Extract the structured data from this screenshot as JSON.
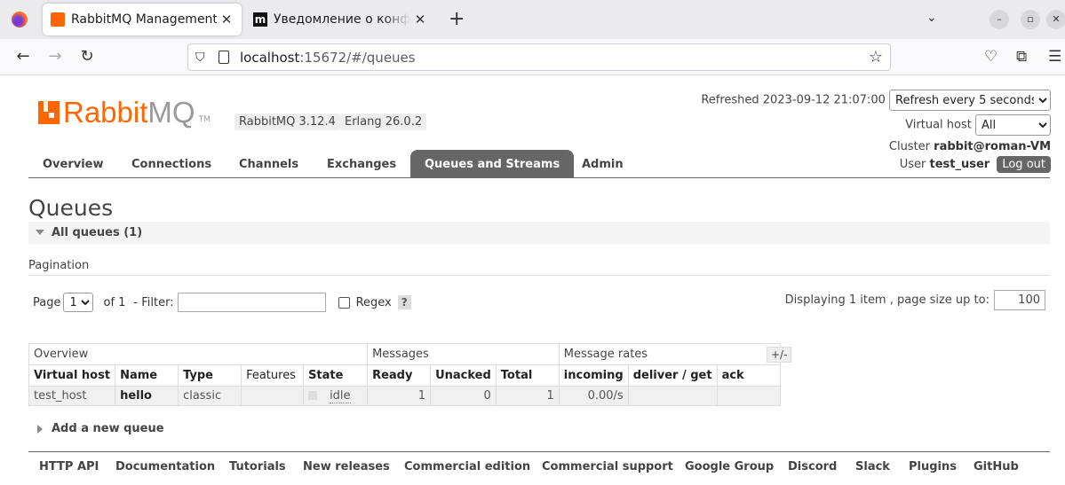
{
  "browser": {
    "tabs": [
      {
        "title": "RabbitMQ Management",
        "active": true,
        "favicon": "rabbitmq-favicon"
      },
      {
        "title": "Уведомление о конфиденциальности",
        "active": false,
        "favicon": "m-favicon"
      }
    ],
    "url_host": "localhost",
    "url_rest": ":15672/#/queues"
  },
  "header": {
    "logo_rabbit": "Rabbit",
    "logo_mq": "MQ",
    "logo_tm": "TM",
    "rabbitmq_version": "RabbitMQ 3.12.4",
    "erlang_version": "Erlang 26.0.2",
    "refreshed": "Refreshed 2023-09-12 21:07:00",
    "refresh_selected": "Refresh every 5 seconds",
    "vhost_label": "Virtual host",
    "vhost_selected": "All",
    "cluster_label": "Cluster",
    "cluster_name": "rabbit@roman-VM",
    "user_label": "User",
    "user_name": "test_user",
    "logout_label": "Log out"
  },
  "nav": {
    "items": [
      "Overview",
      "Connections",
      "Channels",
      "Exchanges",
      "Queues and Streams",
      "Admin"
    ],
    "selected": "Queues and Streams"
  },
  "main": {
    "title": "Queues",
    "section_title": "All queues (1)",
    "pagination_label": "Pagination",
    "page_label": "Page",
    "page_selected": "1",
    "of_label": "of 1",
    "filter_label": "- Filter:",
    "filter_value": "",
    "regex_label": "Regex",
    "help_label": "?",
    "display_info": "Displaying 1 item , page size up to:",
    "page_size": "100",
    "plusminus": "+/-",
    "add_queue": "Add a new queue"
  },
  "table": {
    "groups": [
      "Overview",
      "Messages",
      "Message rates"
    ],
    "columns": [
      "Virtual host",
      "Name",
      "Type",
      "Features",
      "State",
      "Ready",
      "Unacked",
      "Total",
      "incoming",
      "deliver / get",
      "ack"
    ],
    "rows": [
      {
        "vhost": "test_host",
        "name": "hello",
        "type": "classic",
        "features": "",
        "state": "idle",
        "ready": "1",
        "unacked": "0",
        "total": "1",
        "incoming": "0.00/s",
        "deliver_get": "",
        "ack": ""
      }
    ]
  },
  "footer": [
    "HTTP API",
    "Documentation",
    "Tutorials",
    "New releases",
    "Commercial edition",
    "Commercial support",
    "Google Group",
    "Discord",
    "Slack",
    "Plugins",
    "GitHub"
  ],
  "colors": {
    "brand": "#ff6600",
    "nav_selected_bg": "#666666"
  }
}
